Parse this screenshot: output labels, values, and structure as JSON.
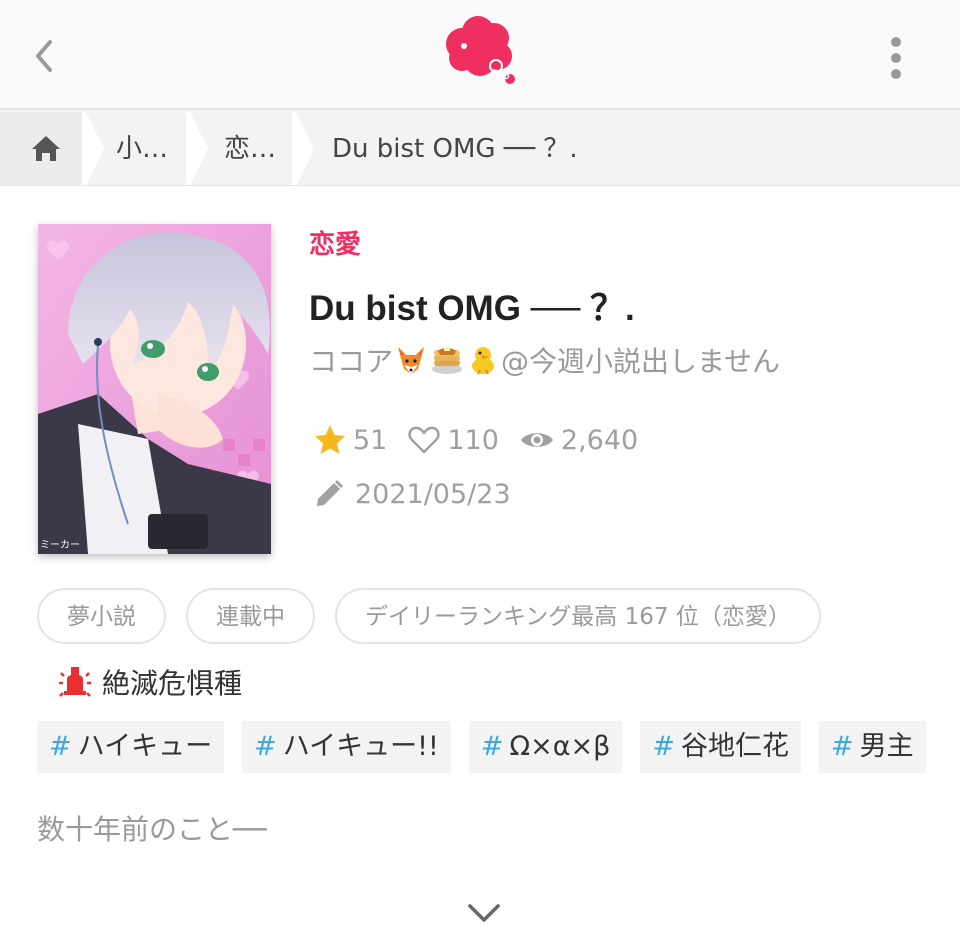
{
  "header": {
    "back_icon": "chevron-left-icon",
    "logo_icon": "thought-bubble-logo",
    "more_icon": "more-vertical-icon",
    "brand_color": "#ee2f5f"
  },
  "breadcrumb": {
    "home_icon": "home-icon",
    "items": [
      "小…",
      "恋…"
    ],
    "current": "Du bist OMG ── ？."
  },
  "story": {
    "genre": "恋愛",
    "title": "Du bist OMG ── ？.",
    "author_prefix": "ココア",
    "author_emojis": [
      "fox-emoji",
      "pancakes-emoji",
      "chick-emoji"
    ],
    "author_suffix": "@今週小説出しません",
    "stars": "51",
    "likes": "110",
    "views": "2,640",
    "updated": "2021/05/23",
    "chips": [
      "夢小説",
      "連載中",
      "デイリーランキング最高 167 位（恋愛）"
    ],
    "badge": "絶滅危惧種",
    "tags": [
      "ハイキュー",
      "ハイキュー!!",
      "Ω×α×β",
      "谷地仁花",
      "男主"
    ],
    "tag_symbol": "#",
    "description": "数十年前のこと──"
  },
  "colors": {
    "star": "#f5b91f",
    "tag_hash": "#3aa9dd",
    "badge_red": "#ee2f2f"
  }
}
